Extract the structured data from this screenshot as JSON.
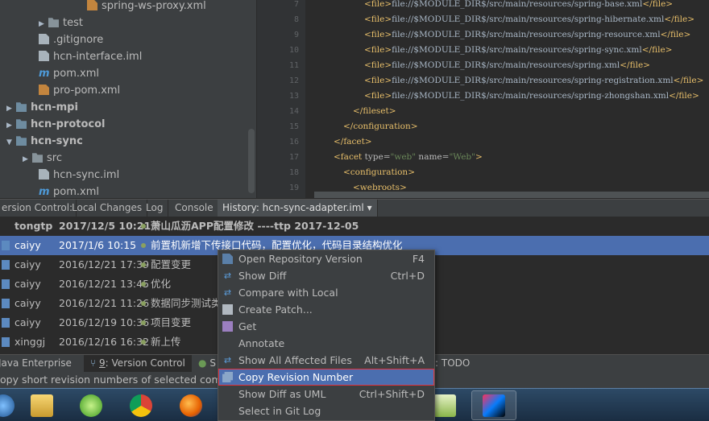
{
  "project_tree": {
    "items": [
      {
        "label": "spring-ws-proxy.xml",
        "icon": "xml-file-icon"
      },
      {
        "label": "test",
        "icon": "folder-icon",
        "arrow": "▶"
      },
      {
        "label": ".gitignore",
        "icon": "file-icon"
      },
      {
        "label": "hcn-interface.iml",
        "icon": "iml-file-icon"
      },
      {
        "label": "pom.xml",
        "icon": "maven-icon"
      },
      {
        "label": "pro-pom.xml",
        "icon": "xml-file-icon"
      },
      {
        "label": "hcn-mpi",
        "icon": "module-folder-icon",
        "arrow": "▶"
      },
      {
        "label": "hcn-protocol",
        "icon": "module-folder-icon",
        "arrow": "▶"
      },
      {
        "label": "hcn-sync",
        "icon": "module-folder-icon",
        "arrow": "▼"
      },
      {
        "label": "src",
        "icon": "folder-icon",
        "arrow": "▶"
      },
      {
        "label": "hcn-sync.iml",
        "icon": "iml-file-icon"
      },
      {
        "label": "pom.xml",
        "icon": "maven-icon"
      }
    ]
  },
  "editor": {
    "line_numbers": [
      "7",
      "8",
      "9",
      "10",
      "11",
      "12",
      "13",
      "14",
      "15",
      "16",
      "17",
      "18",
      "19"
    ],
    "lines": [
      {
        "open": "<file>",
        "text": "file://$MODULE_DIR$/src/main/resources/spring-base.xml",
        "close": "</file>"
      },
      {
        "open": "<file>",
        "text": "file://$MODULE_DIR$/src/main/resources/spring-hibernate.xml",
        "close": "</file>"
      },
      {
        "open": "<file>",
        "text": "file://$MODULE_DIR$/src/main/resources/spring-resource.xml",
        "close": "</file>"
      },
      {
        "open": "<file>",
        "text": "file://$MODULE_DIR$/src/main/resources/spring-sync.xml",
        "close": "</file>"
      },
      {
        "open": "<file>",
        "text": "file://$MODULE_DIR$/src/main/resources/spring.xml",
        "close": "</file>"
      },
      {
        "open": "<file>",
        "text": "file://$MODULE_DIR$/src/main/resources/spring-registration.xml",
        "close": "</file>"
      },
      {
        "open": "<file>",
        "text": "file://$MODULE_DIR$/src/main/resources/spring-zhongshan.xml",
        "close": "</file>"
      },
      {
        "open": "</fileset>",
        "text": "",
        "close": ""
      },
      {
        "open": "</configuration>",
        "text": "",
        "close": ""
      },
      {
        "open": "</facet>",
        "text": "",
        "close": ""
      },
      {
        "open": "<facet ",
        "attr1": "type=",
        "val1": "\"web\"",
        "attr2": " name=",
        "val2": "\"Web\"",
        "close": ">"
      },
      {
        "open": "<configuration>",
        "text": "",
        "close": ""
      },
      {
        "open": "<webroots>",
        "text": "",
        "close": ""
      }
    ]
  },
  "vc_tabs": {
    "title": "ersion Control:",
    "local_changes": "Local Changes",
    "log": "Log",
    "console": "Console",
    "history": "History: hcn-sync-adapter.iml",
    "history_arrow": "▾"
  },
  "history": {
    "rows": [
      {
        "author": "tongtp",
        "date": "2017/12/5 10:21",
        "message": "萧山瓜沥APP配置修改  ----ttp 2017-12-05",
        "bold": true
      },
      {
        "author": "caiyy",
        "date": "2017/1/6 10:15",
        "message": "前置机新增下传接口代码，配置优化，代码目录结构优化",
        "selected": true
      },
      {
        "author": "caiyy",
        "date": "2016/12/21 17:39",
        "message": "配置变更"
      },
      {
        "author": "caiyy",
        "date": "2016/12/21 13:45",
        "message": "优化"
      },
      {
        "author": "caiyy",
        "date": "2016/12/21 11:26",
        "message": "数据同步测试类"
      },
      {
        "author": "caiyy",
        "date": "2016/12/19 10:36",
        "message": "项目变更"
      },
      {
        "author": "xinggj",
        "date": "2016/12/16 16:32",
        "message": "新上传"
      }
    ]
  },
  "bottom_tabs": {
    "java_enterprise": "Java Enterprise",
    "version_control_num": "9",
    "version_control": ": Version Control",
    "spring": "S",
    "todo": ": TODO"
  },
  "status_bar": {
    "text": "opy short revision numbers of selected comm"
  },
  "context_menu": {
    "items": [
      {
        "label": "Open Repository Version",
        "shortcut": "F4",
        "icon": "open-repo-icon"
      },
      {
        "label": "Show Diff",
        "shortcut": "Ctrl+D",
        "icon": "diff-icon"
      },
      {
        "label": "Compare with Local",
        "shortcut": "",
        "icon": "compare-icon"
      },
      {
        "label": "Create Patch...",
        "shortcut": "",
        "icon": "patch-icon"
      },
      {
        "label": "Get",
        "shortcut": "",
        "icon": "get-icon"
      },
      {
        "label": "Annotate",
        "shortcut": "",
        "icon": ""
      },
      {
        "label": "Show All Affected Files",
        "shortcut": "Alt+Shift+A",
        "icon": "affected-files-icon"
      },
      {
        "label": "Copy Revision Number",
        "shortcut": "",
        "icon": "copy-icon",
        "selected": true
      },
      {
        "label": "Show Diff as UML",
        "shortcut": "Ctrl+Shift+D",
        "icon": ""
      },
      {
        "label": "Select in Git Log",
        "shortcut": "",
        "icon": ""
      }
    ]
  },
  "taskbar": {
    "apps": [
      "file-explorer-icon",
      "sync-app-icon",
      "chrome-icon",
      "firefox-icon",
      "notepad-icon",
      "intellij-icon"
    ]
  },
  "colors": {
    "selection": "#4b6eaf",
    "highlight_border": "#e0333e",
    "editor_bg": "#2b2b2b",
    "panel_bg": "#3c3f41"
  }
}
